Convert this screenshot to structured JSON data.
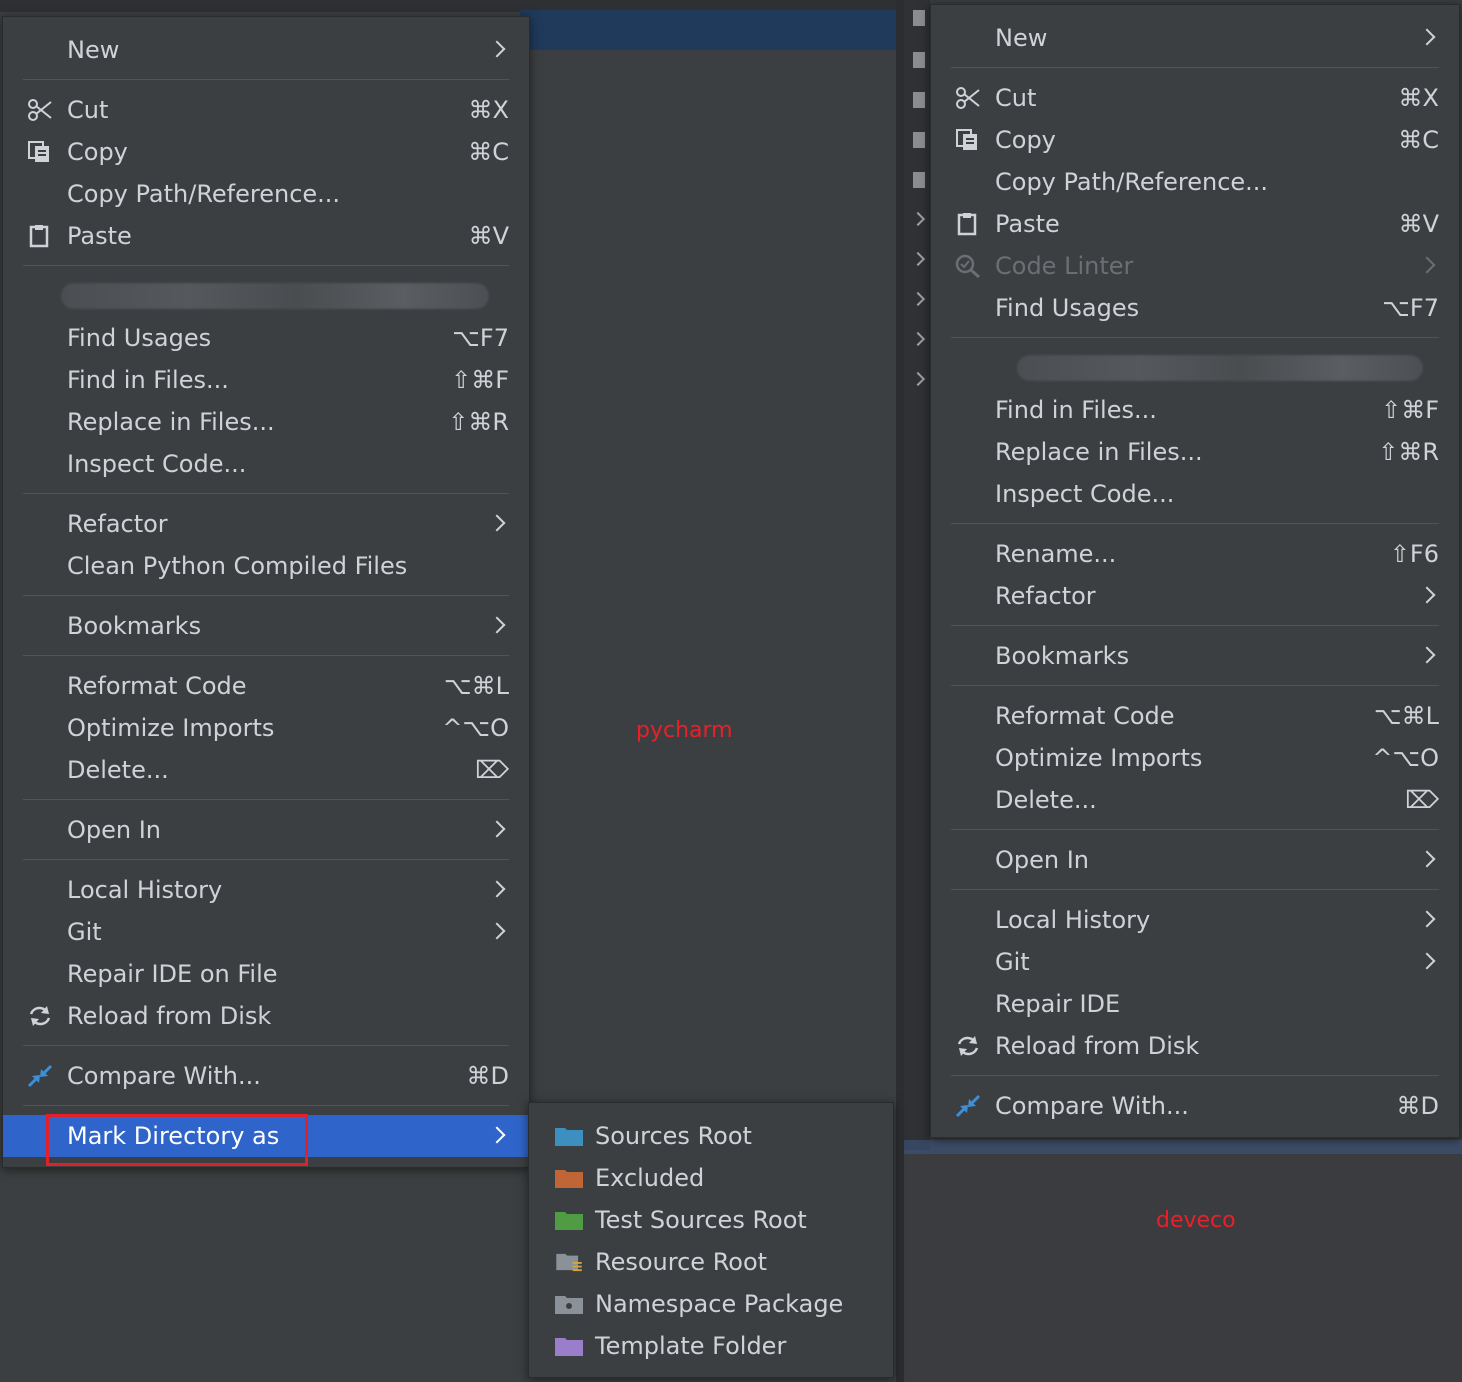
{
  "captions": {
    "pycharm": "pycharm",
    "deveco": "deveco"
  },
  "pycharm_menu": {
    "items": [
      {
        "label": "New",
        "submenu": true
      },
      {
        "label": "Cut",
        "shortcut": "⌘X",
        "icon": "scissors-icon"
      },
      {
        "label": "Copy",
        "shortcut": "⌘C",
        "icon": "copy-icon"
      },
      {
        "label": "Copy Path/Reference..."
      },
      {
        "label": "Paste",
        "shortcut": "⌘V",
        "icon": "clipboard-icon"
      },
      {
        "label": "Find Usages",
        "shortcut": "⌥F7"
      },
      {
        "label": "Find in Files...",
        "shortcut": "⇧⌘F"
      },
      {
        "label": "Replace in Files...",
        "shortcut": "⇧⌘R"
      },
      {
        "label": "Inspect Code..."
      },
      {
        "label": "Refactor",
        "submenu": true
      },
      {
        "label": "Clean Python Compiled Files"
      },
      {
        "label": "Bookmarks",
        "submenu": true
      },
      {
        "label": "Reformat Code",
        "shortcut": "⌥⌘L"
      },
      {
        "label": "Optimize Imports",
        "shortcut": "^⌥O"
      },
      {
        "label": "Delete...",
        "shortcut": "⌦"
      },
      {
        "label": "Open In",
        "submenu": true
      },
      {
        "label": "Local History",
        "submenu": true
      },
      {
        "label": "Git",
        "submenu": true
      },
      {
        "label": "Repair IDE on File"
      },
      {
        "label": "Reload from Disk",
        "icon": "reload-icon"
      },
      {
        "label": "Compare With...",
        "shortcut": "⌘D",
        "icon": "compare-icon"
      },
      {
        "label": "Mark Directory as",
        "submenu": true,
        "selected": true
      }
    ]
  },
  "mark_directory_submenu": {
    "items": [
      {
        "label": "Sources Root",
        "color": "#3d8fbf"
      },
      {
        "label": "Excluded",
        "color": "#c06535"
      },
      {
        "label": "Test Sources Root",
        "color": "#4f9c45"
      },
      {
        "label": "Resource Root",
        "color": "#8a9199"
      },
      {
        "label": "Namespace Package",
        "color": "#8a9199"
      },
      {
        "label": "Template Folder",
        "color": "#9b7ec9"
      }
    ]
  },
  "deveco_menu": {
    "items": [
      {
        "label": "New",
        "submenu": true
      },
      {
        "label": "Cut",
        "shortcut": "⌘X",
        "icon": "scissors-icon"
      },
      {
        "label": "Copy",
        "shortcut": "⌘C",
        "icon": "copy-icon"
      },
      {
        "label": "Copy Path/Reference..."
      },
      {
        "label": "Paste",
        "shortcut": "⌘V",
        "icon": "clipboard-icon"
      },
      {
        "label": "Code Linter",
        "submenu": true,
        "disabled": true,
        "icon": "linter-icon"
      },
      {
        "label": "Find Usages",
        "shortcut": "⌥F7"
      },
      {
        "label": "Find in Files...",
        "shortcut": "⇧⌘F"
      },
      {
        "label": "Replace in Files...",
        "shortcut": "⇧⌘R"
      },
      {
        "label": "Inspect Code..."
      },
      {
        "label": "Rename...",
        "shortcut": "⇧F6"
      },
      {
        "label": "Refactor",
        "submenu": true
      },
      {
        "label": "Bookmarks",
        "submenu": true
      },
      {
        "label": "Reformat Code",
        "shortcut": "⌥⌘L"
      },
      {
        "label": "Optimize Imports",
        "shortcut": "^⌥O"
      },
      {
        "label": "Delete...",
        "shortcut": "⌦"
      },
      {
        "label": "Open In",
        "submenu": true
      },
      {
        "label": "Local History",
        "submenu": true
      },
      {
        "label": "Git",
        "submenu": true
      },
      {
        "label": "Repair IDE"
      },
      {
        "label": "Reload from Disk",
        "icon": "reload-icon"
      },
      {
        "label": "Compare With...",
        "shortcut": "⌘D",
        "icon": "compare-icon"
      }
    ]
  }
}
